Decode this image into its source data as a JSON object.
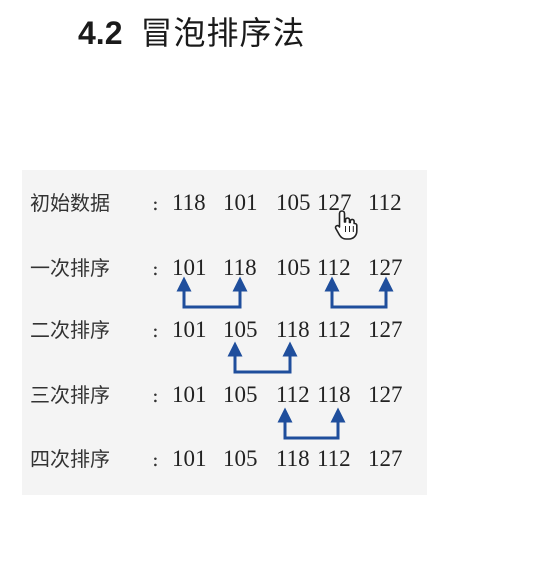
{
  "title": {
    "number": "4.2",
    "text": "冒泡排序法"
  },
  "colors": {
    "arrow": "#1f4e9c",
    "text": "#222222",
    "panel": "#f4f4f4"
  },
  "rows": [
    {
      "label": "初始数据",
      "colon": ":",
      "values": [
        "118",
        "101",
        "105",
        "127",
        "112"
      ]
    },
    {
      "label": "一次排序",
      "colon": ":",
      "values": [
        "101",
        "118",
        "105",
        "112",
        "127"
      ]
    },
    {
      "label": "二次排序",
      "colon": ":",
      "values": [
        "101",
        "105",
        "118",
        "112",
        "127"
      ]
    },
    {
      "label": "三次排序",
      "colon": ":",
      "values": [
        "101",
        "105",
        "112",
        "118",
        "127"
      ]
    },
    {
      "label": "四次排序",
      "colon": ":",
      "values": [
        "101",
        "105",
        "118",
        "112",
        "127"
      ]
    }
  ],
  "swaps": [
    {
      "between_rows": [
        1,
        2
      ],
      "columns": [
        0,
        1
      ]
    },
    {
      "between_rows": [
        1,
        2
      ],
      "columns": [
        3,
        4
      ]
    },
    {
      "between_rows": [
        2,
        3
      ],
      "columns": [
        1,
        2
      ]
    },
    {
      "between_rows": [
        3,
        4
      ],
      "columns": [
        2,
        3
      ]
    }
  ],
  "cursor_icon": "hand-pointer-icon"
}
